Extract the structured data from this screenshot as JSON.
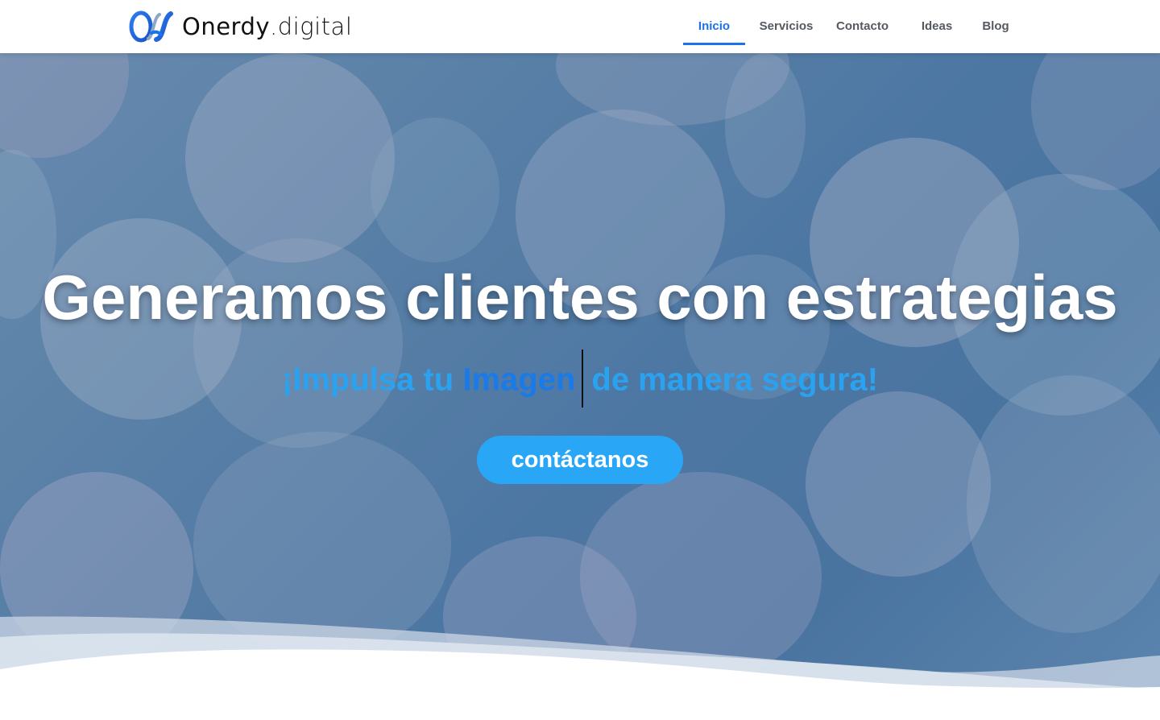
{
  "brand": {
    "name": "Onerdy",
    "suffix": ".digital",
    "logo_icon": "onerdy-logo-mark",
    "colors": {
      "primary": "#1a73e8",
      "accent": "#29a6f6"
    }
  },
  "nav": {
    "items": [
      {
        "label": "Inicio",
        "active": true
      },
      {
        "label": "Servicios",
        "active": false
      },
      {
        "label": "Contacto",
        "active": false
      },
      {
        "label": "Ideas",
        "active": false
      },
      {
        "label": "Blog",
        "active": false
      }
    ]
  },
  "hero": {
    "headline": "Generamos clientes con estrategias",
    "sub_prefix": "¡Impulsa tu ",
    "sub_highlight": "Imagen",
    "sub_suffix": "de manera segura!",
    "cta_label": "contáctanos"
  }
}
